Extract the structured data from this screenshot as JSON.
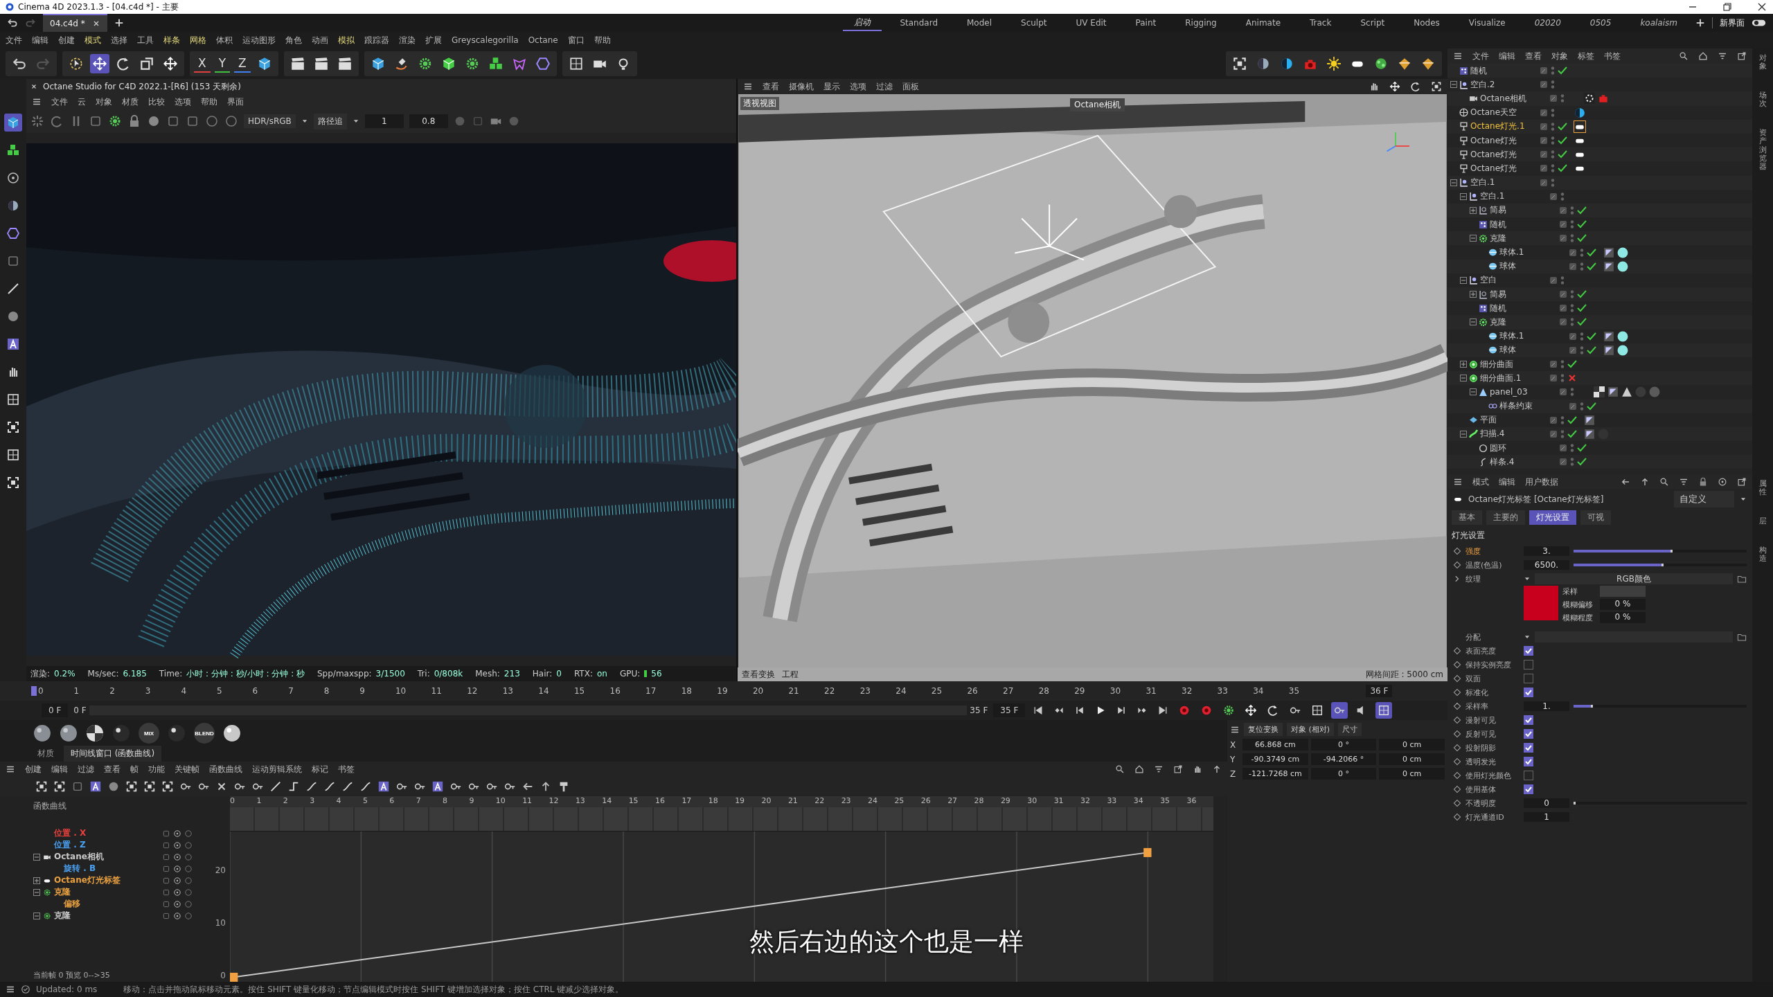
{
  "window": {
    "title": "Cinema 4D 2023.1.3 - [04.c4d *] - 主要"
  },
  "doc_tabs": [
    {
      "label": "04.c4d *",
      "selected": true
    }
  ],
  "layout_tabs": [
    {
      "label": "启动",
      "selected": true,
      "kind": "custom"
    },
    {
      "label": "Standard",
      "selected": false,
      "kind": "builtin"
    },
    {
      "label": "Model",
      "selected": false,
      "kind": "builtin"
    },
    {
      "label": "Sculpt",
      "selected": false,
      "kind": "builtin"
    },
    {
      "label": "UV Edit",
      "selected": false,
      "kind": "builtin"
    },
    {
      "label": "Paint",
      "selected": false,
      "kind": "builtin"
    },
    {
      "label": "Rigging",
      "selected": false,
      "kind": "builtin"
    },
    {
      "label": "Animate",
      "selected": false,
      "kind": "builtin"
    },
    {
      "label": "Track",
      "selected": false,
      "kind": "builtin"
    },
    {
      "label": "Script",
      "selected": false,
      "kind": "builtin"
    },
    {
      "label": "Nodes",
      "selected": false,
      "kind": "builtin"
    },
    {
      "label": "Visualize",
      "selected": false,
      "kind": "builtin"
    },
    {
      "label": "02020",
      "selected": false,
      "kind": "custom"
    },
    {
      "label": "0505",
      "selected": false,
      "kind": "custom"
    },
    {
      "label": "koalaism",
      "selected": false,
      "kind": "custom"
    }
  ],
  "new_layout": "新界面",
  "menu": [
    {
      "label": "文件",
      "highlight": false
    },
    {
      "label": "编辑",
      "highlight": false
    },
    {
      "label": "创建",
      "highlight": false
    },
    {
      "label": "模式",
      "highlight": true
    },
    {
      "label": "选择",
      "highlight": false
    },
    {
      "label": "工具",
      "highlight": false
    },
    {
      "label": "样条",
      "highlight": true
    },
    {
      "label": "网格",
      "highlight": true
    },
    {
      "label": "体积",
      "highlight": false
    },
    {
      "label": "运动图形",
      "highlight": false
    },
    {
      "label": "角色",
      "highlight": false
    },
    {
      "label": "动画",
      "highlight": false
    },
    {
      "label": "模拟",
      "highlight": true
    },
    {
      "label": "跟踪器",
      "highlight": false
    },
    {
      "label": "渲染",
      "highlight": false
    },
    {
      "label": "扩展",
      "highlight": false
    },
    {
      "label": "Greyscalegorilla",
      "highlight": false
    },
    {
      "label": "Octane",
      "highlight": false
    },
    {
      "label": "窗口",
      "highlight": false
    },
    {
      "label": "帮助",
      "highlight": false
    }
  ],
  "axis_buttons": [
    "X",
    "Y",
    "Z"
  ],
  "octane": {
    "title": "Octane Studio for C4D 2022.1-[R6] (153 天剩余)",
    "menu": [
      "文件",
      "云",
      "对象",
      "材质",
      "比较",
      "选项",
      "帮助",
      "界面"
    ],
    "color_mode": "HDR/sRGB",
    "kernel": "路径追",
    "value_a": "1",
    "value_b": "0.8",
    "status": [
      {
        "label": "渲染:",
        "value": "0.2%"
      },
      {
        "label": "Ms/sec:",
        "value": "6.185"
      },
      {
        "label": "Time:",
        "value": "小时 : 分钟 : 秒/小时 : 分钟 : 秒"
      },
      {
        "label": "Spp/maxspp:",
        "value": "3/1500"
      },
      {
        "label": "Tri:",
        "value": "0/808k"
      },
      {
        "label": "Mesh:",
        "value": "213"
      },
      {
        "label": "Hair:",
        "value": "0"
      },
      {
        "label": "RTX:",
        "value": "on"
      },
      {
        "label": "GPU:",
        "value": "56"
      }
    ]
  },
  "viewport": {
    "menu": [
      "查看",
      "摄像机",
      "显示",
      "选项",
      "过滤",
      "面板"
    ],
    "view_label": "透视视图",
    "camera_label": "Octane相机",
    "bottom_left": [
      "查看变换",
      "工程"
    ],
    "grid_spacing": "网格间距 : 5000 cm"
  },
  "timeline": {
    "ticks": [
      "0",
      "1",
      "2",
      "3",
      "4",
      "5",
      "6",
      "7",
      "8",
      "9",
      "10",
      "11",
      "12",
      "13",
      "14",
      "15",
      "16",
      "17",
      "18",
      "19",
      "20",
      "21",
      "22",
      "23",
      "24",
      "25",
      "26",
      "27",
      "28",
      "29",
      "30",
      "31",
      "32",
      "33",
      "34",
      "35"
    ],
    "end_label": "36 F",
    "start_field": "0 F",
    "preview_start": "0 F",
    "preview_end": "35 F",
    "end_field": "35 F"
  },
  "materials": [
    {
      "kind": "grey"
    },
    {
      "kind": "grey"
    },
    {
      "kind": "checker"
    },
    {
      "kind": "dark"
    },
    {
      "kind": "mix",
      "label": "MIX"
    },
    {
      "kind": "dark"
    },
    {
      "kind": "mix",
      "label": "BLEND"
    },
    {
      "kind": "light"
    }
  ],
  "bottom_tabs": [
    {
      "label": "材质",
      "selected": false
    },
    {
      "label": "时间线窗口 (函数曲线)",
      "selected": true
    }
  ],
  "curve_menu": [
    "创建",
    "编辑",
    "过滤",
    "查看",
    "帧",
    "功能",
    "关键帧",
    "函数曲线",
    "运动剪辑系统",
    "标记",
    "书签"
  ],
  "curve_editor": {
    "title": "函数曲线",
    "ruler": [
      "0",
      "1",
      "2",
      "3",
      "4",
      "5",
      "6",
      "7",
      "8",
      "9",
      "10",
      "11",
      "12",
      "13",
      "14",
      "15",
      "16",
      "17",
      "18",
      "19",
      "20",
      "21",
      "22",
      "23",
      "24",
      "25",
      "26",
      "27",
      "28",
      "29",
      "30",
      "31",
      "32",
      "33",
      "34",
      "35",
      "36"
    ],
    "y_ticks": [
      "20",
      "10",
      "0"
    ],
    "footer": "当前帧 0 预览 0-->35",
    "tracks": [
      {
        "label": "位置 . X",
        "color": "#e8403c"
      },
      {
        "label": "位置 . Z",
        "color": "#4aa0f0"
      },
      {
        "label": "Octane相机",
        "color": "#c8c8c8",
        "kind": "camera",
        "expanded": true,
        "children": [
          {
            "label": "旋转 . B",
            "color": "#4aa0f0"
          }
        ]
      },
      {
        "label": "Octane灯光标签",
        "color": "#e8a040",
        "kind": "light-tag",
        "expanded": false
      },
      {
        "label": "克隆",
        "color": "#e8a040",
        "kind": "cloner",
        "expanded": true,
        "children": [
          {
            "label": "偏移",
            "color": "#e8a040"
          }
        ]
      },
      {
        "label": "克隆",
        "color": "#c8c8c8",
        "kind": "cloner",
        "expanded": true
      }
    ]
  },
  "coords": {
    "header": [
      "复位变换",
      "对象 (相对)",
      "尺寸"
    ],
    "rows": [
      {
        "axis": "X",
        "pos": "66.868 cm",
        "rot": "0 °",
        "size": "0 cm"
      },
      {
        "axis": "Y",
        "pos": "-90.3749 cm",
        "rot": "-94.2066 °",
        "size": "0 cm"
      },
      {
        "axis": "Z",
        "pos": "-121.7268 cm",
        "rot": "0 °",
        "size": "0 cm"
      }
    ]
  },
  "object_manager": {
    "menu": [
      "文件",
      "编辑",
      "查看",
      "对象",
      "标签",
      "书签"
    ],
    "items": [
      {
        "name": "随机",
        "kind": "random",
        "enabled": true,
        "selected": false
      },
      {
        "name": "空白.2",
        "kind": "null",
        "selected": false,
        "expanded": true,
        "children": [
          {
            "name": "Octane相机",
            "kind": "camera",
            "selected": false,
            "tags": [
              {
                "kind": "target",
                "selected": false
              },
              {
                "kind": "camera-tag",
                "selected": false
              }
            ]
          }
        ]
      },
      {
        "name": "Octane天空",
        "kind": "sky",
        "selected": false,
        "tags": [
          {
            "kind": "sky-tag",
            "selected": false
          }
        ]
      },
      {
        "name": "Octane灯光.1",
        "kind": "light",
        "enabled": true,
        "selected": true,
        "tags": [
          {
            "kind": "light-tag",
            "selected": true
          }
        ]
      },
      {
        "name": "Octane灯光",
        "kind": "light",
        "enabled": true,
        "selected": false,
        "tags": [
          {
            "kind": "light-tag",
            "selected": false
          }
        ]
      },
      {
        "name": "Octane灯光",
        "kind": "light",
        "enabled": true,
        "selected": false,
        "tags": [
          {
            "kind": "light-tag",
            "selected": false
          }
        ]
      },
      {
        "name": "Octane灯光",
        "kind": "light",
        "enabled": true,
        "selected": false,
        "tags": [
          {
            "kind": "light-tag",
            "selected": false
          }
        ]
      },
      {
        "name": "空白.1",
        "kind": "null",
        "selected": false,
        "expanded": true,
        "children": [
          {
            "name": "空白.1",
            "kind": "null",
            "selected": false,
            "expanded": true,
            "children": [
              {
                "name": "简易",
                "kind": "effector",
                "enabled": true,
                "selected": false,
                "expanded": false
              },
              {
                "name": "随机",
                "kind": "random",
                "enabled": true,
                "selected": false
              },
              {
                "name": "克隆",
                "kind": "cloner",
                "enabled": true,
                "selected": false,
                "expanded": true,
                "children": [
                  {
                    "name": "球体.1",
                    "kind": "sphere",
                    "enabled": true,
                    "selected": false,
                    "tags": [
                      {
                        "kind": "phong",
                        "selected": false
                      },
                      {
                        "kind": "material",
                        "color": "#8ee8e4",
                        "selected": false
                      }
                    ]
                  },
                  {
                    "name": "球体",
                    "kind": "sphere",
                    "enabled": true,
                    "selected": false,
                    "tags": [
                      {
                        "kind": "phong",
                        "selected": false
                      },
                      {
                        "kind": "material",
                        "color": "#8ee8e4",
                        "selected": false
                      }
                    ]
                  }
                ]
              }
            ]
          },
          {
            "name": "空白",
            "kind": "null",
            "selected": false,
            "expanded": true,
            "children": [
              {
                "name": "简易",
                "kind": "effector",
                "enabled": true,
                "selected": false,
                "expanded": false
              },
              {
                "name": "随机",
                "kind": "random",
                "enabled": true,
                "selected": false
              },
              {
                "name": "克隆",
                "kind": "cloner",
                "enabled": true,
                "selected": false,
                "expanded": true,
                "children": [
                  {
                    "name": "球体.1",
                    "kind": "sphere",
                    "enabled": true,
                    "selected": false,
                    "tags": [
                      {
                        "kind": "phong",
                        "selected": false
                      },
                      {
                        "kind": "material",
                        "color": "#8ee8e4",
                        "selected": false
                      }
                    ]
                  },
                  {
                    "name": "球体",
                    "kind": "sphere",
                    "enabled": true,
                    "selected": false,
                    "tags": [
                      {
                        "kind": "phong",
                        "selected": false
                      },
                      {
                        "kind": "material",
                        "color": "#8ee8e4",
                        "selected": false
                      }
                    ]
                  }
                ]
              }
            ]
          },
          {
            "name": "细分曲面",
            "kind": "subdiv",
            "enabled": true,
            "selected": false,
            "expanded": false
          },
          {
            "name": "细分曲面.1",
            "kind": "subdiv",
            "enabled": false,
            "selected": false,
            "expanded": true,
            "children": [
              {
                "name": "panel_03",
                "kind": "poly",
                "selected": false,
                "expanded": true,
                "tags": [
                  {
                    "kind": "checker",
                    "selected": false
                  },
                  {
                    "kind": "phong",
                    "selected": false
                  },
                  {
                    "kind": "triangle",
                    "selected": false
                  },
                  {
                    "kind": "material",
                    "color": "#3a3a3a",
                    "selected": false
                  },
                  {
                    "kind": "material",
                    "color": "#5a5a5a",
                    "selected": false
                  }
                ],
                "children": [
                  {
                    "name": "样条约束",
                    "kind": "constraint",
                    "enabled": true,
                    "selected": false
                  }
                ]
              }
            ]
          },
          {
            "name": "平面",
            "kind": "plane",
            "enabled": true,
            "selected": false,
            "tags": [
              {
                "kind": "phong",
                "selected": false
              }
            ]
          },
          {
            "name": "扫描.4",
            "kind": "sweep",
            "enabled": true,
            "selected": false,
            "expanded": true,
            "tags": [
              {
                "kind": "phong",
                "selected": false
              },
              {
                "kind": "material",
                "color": "#333333",
                "selected": false
              }
            ],
            "children": [
              {
                "name": "圆环",
                "kind": "circle",
                "enabled": true,
                "selected": false
              },
              {
                "name": "样条.4",
                "kind": "spline",
                "enabled": true,
                "selected": false
              }
            ]
          }
        ]
      }
    ]
  },
  "side_tabs_top": [
    "对象",
    "场次",
    "资产浏览器"
  ],
  "attributes": {
    "menu": [
      "模式",
      "编辑",
      "用户数据"
    ],
    "title": "Octane灯光标签 [Octane灯光标签]",
    "preset": "自定义",
    "tabs": [
      {
        "label": "基本",
        "selected": false
      },
      {
        "label": "主要的",
        "selected": false
      },
      {
        "label": "灯光设置",
        "selected": true
      },
      {
        "label": "可视",
        "selected": false
      }
    ],
    "section": "灯光设置",
    "rows": [
      {
        "kind": "slider",
        "label": "强度",
        "value": "3.",
        "level": 0.57,
        "animated": true
      },
      {
        "kind": "slider",
        "label": "温度(色温)",
        "value": "6500.",
        "level": 0.52,
        "animated": false
      },
      {
        "kind": "texture",
        "label": "纹理",
        "value": "RGB颜色"
      },
      {
        "kind": "color",
        "color": "#c8001e",
        "fields": [
          {
            "label": "采样"
          },
          {
            "label": "模糊偏移",
            "value": "0 %"
          },
          {
            "label": "模糊程度",
            "value": "0 %"
          }
        ]
      },
      {
        "kind": "dropdown",
        "label": "分配"
      },
      {
        "kind": "checkbox",
        "label": "表面亮度",
        "checked": true,
        "animated": false
      },
      {
        "kind": "checkbox",
        "label": "保持实例亮度",
        "checked": false,
        "animated": false
      },
      {
        "kind": "checkbox",
        "label": "双面",
        "checked": false,
        "animated": false
      },
      {
        "kind": "checkbox",
        "label": "标准化",
        "checked": true,
        "animated": false
      },
      {
        "kind": "slider",
        "label": "采样率",
        "value": "1.",
        "level": 0.11,
        "animated": false
      },
      {
        "kind": "checkbox",
        "label": "漫射可见",
        "checked": true,
        "animated": false
      },
      {
        "kind": "checkbox",
        "label": "反射可见",
        "checked": true,
        "animated": false
      },
      {
        "kind": "checkbox",
        "label": "投射阴影",
        "checked": true,
        "animated": false
      },
      {
        "kind": "checkbox",
        "label": "透明发光",
        "checked": true,
        "animated": false
      },
      {
        "kind": "checkbox",
        "label": "使用灯光颜色",
        "checked": false,
        "animated": false
      },
      {
        "kind": "checkbox",
        "label": "使用基体",
        "checked": true,
        "animated": false
      },
      {
        "kind": "slider",
        "label": "不透明度",
        "value": "0",
        "level": 0,
        "animated": false
      },
      {
        "kind": "number",
        "label": "灯光通道ID",
        "value": "1",
        "animated": false
      }
    ]
  },
  "side_tabs_bottom": [
    "属性",
    "层",
    "构造"
  ],
  "status_bar": {
    "text": "Updated: 0 ms",
    "message": "移动：点击并拖动鼠标移动元素。按住 SHIFT 键量化移动；节点编辑模式时按住 SHIFT 键增加选择对象；按住 CTRL 键减少选择对象。"
  },
  "subtitle": "然后右边的这个也是一样"
}
